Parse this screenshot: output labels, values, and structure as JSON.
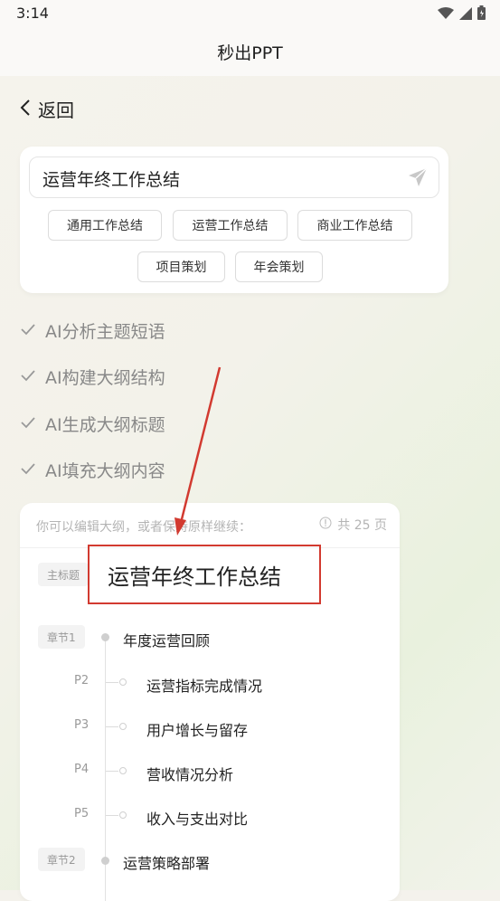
{
  "status_bar": {
    "time": "3:14"
  },
  "app": {
    "title": "秒出PPT"
  },
  "back": {
    "label": "返回"
  },
  "topic": {
    "value": "运营年终工作总结",
    "chips": [
      "通用工作总结",
      "运营工作总结",
      "商业工作总结",
      "项目策划",
      "年会策划"
    ]
  },
  "steps": [
    "AI分析主题短语",
    "AI构建大纲结构",
    "AI生成大纲标题",
    "AI填充大纲内容"
  ],
  "outline": {
    "hint": "你可以编辑大纲，或者保持原样继续：",
    "pages": "共 25 页",
    "main_tag": "主标题",
    "main_title": "运营年终工作总结",
    "chapters": [
      {
        "tag": "章节1",
        "title": "年度运营回顾",
        "pages": [
          {
            "num": "P2",
            "title": "运营指标完成情况"
          },
          {
            "num": "P3",
            "title": "用户增长与留存"
          },
          {
            "num": "P4",
            "title": "营收情况分析"
          },
          {
            "num": "P5",
            "title": "收入与支出对比"
          }
        ]
      },
      {
        "tag": "章节2",
        "title": "运营策略部署"
      }
    ]
  },
  "colors": {
    "annotation_red": "#d23a30",
    "check": "#999999"
  },
  "icons": [
    "chevron-left-icon",
    "send-icon",
    "check-icon",
    "info-icon",
    "wifi-icon",
    "signal-icon",
    "battery-icon"
  ]
}
